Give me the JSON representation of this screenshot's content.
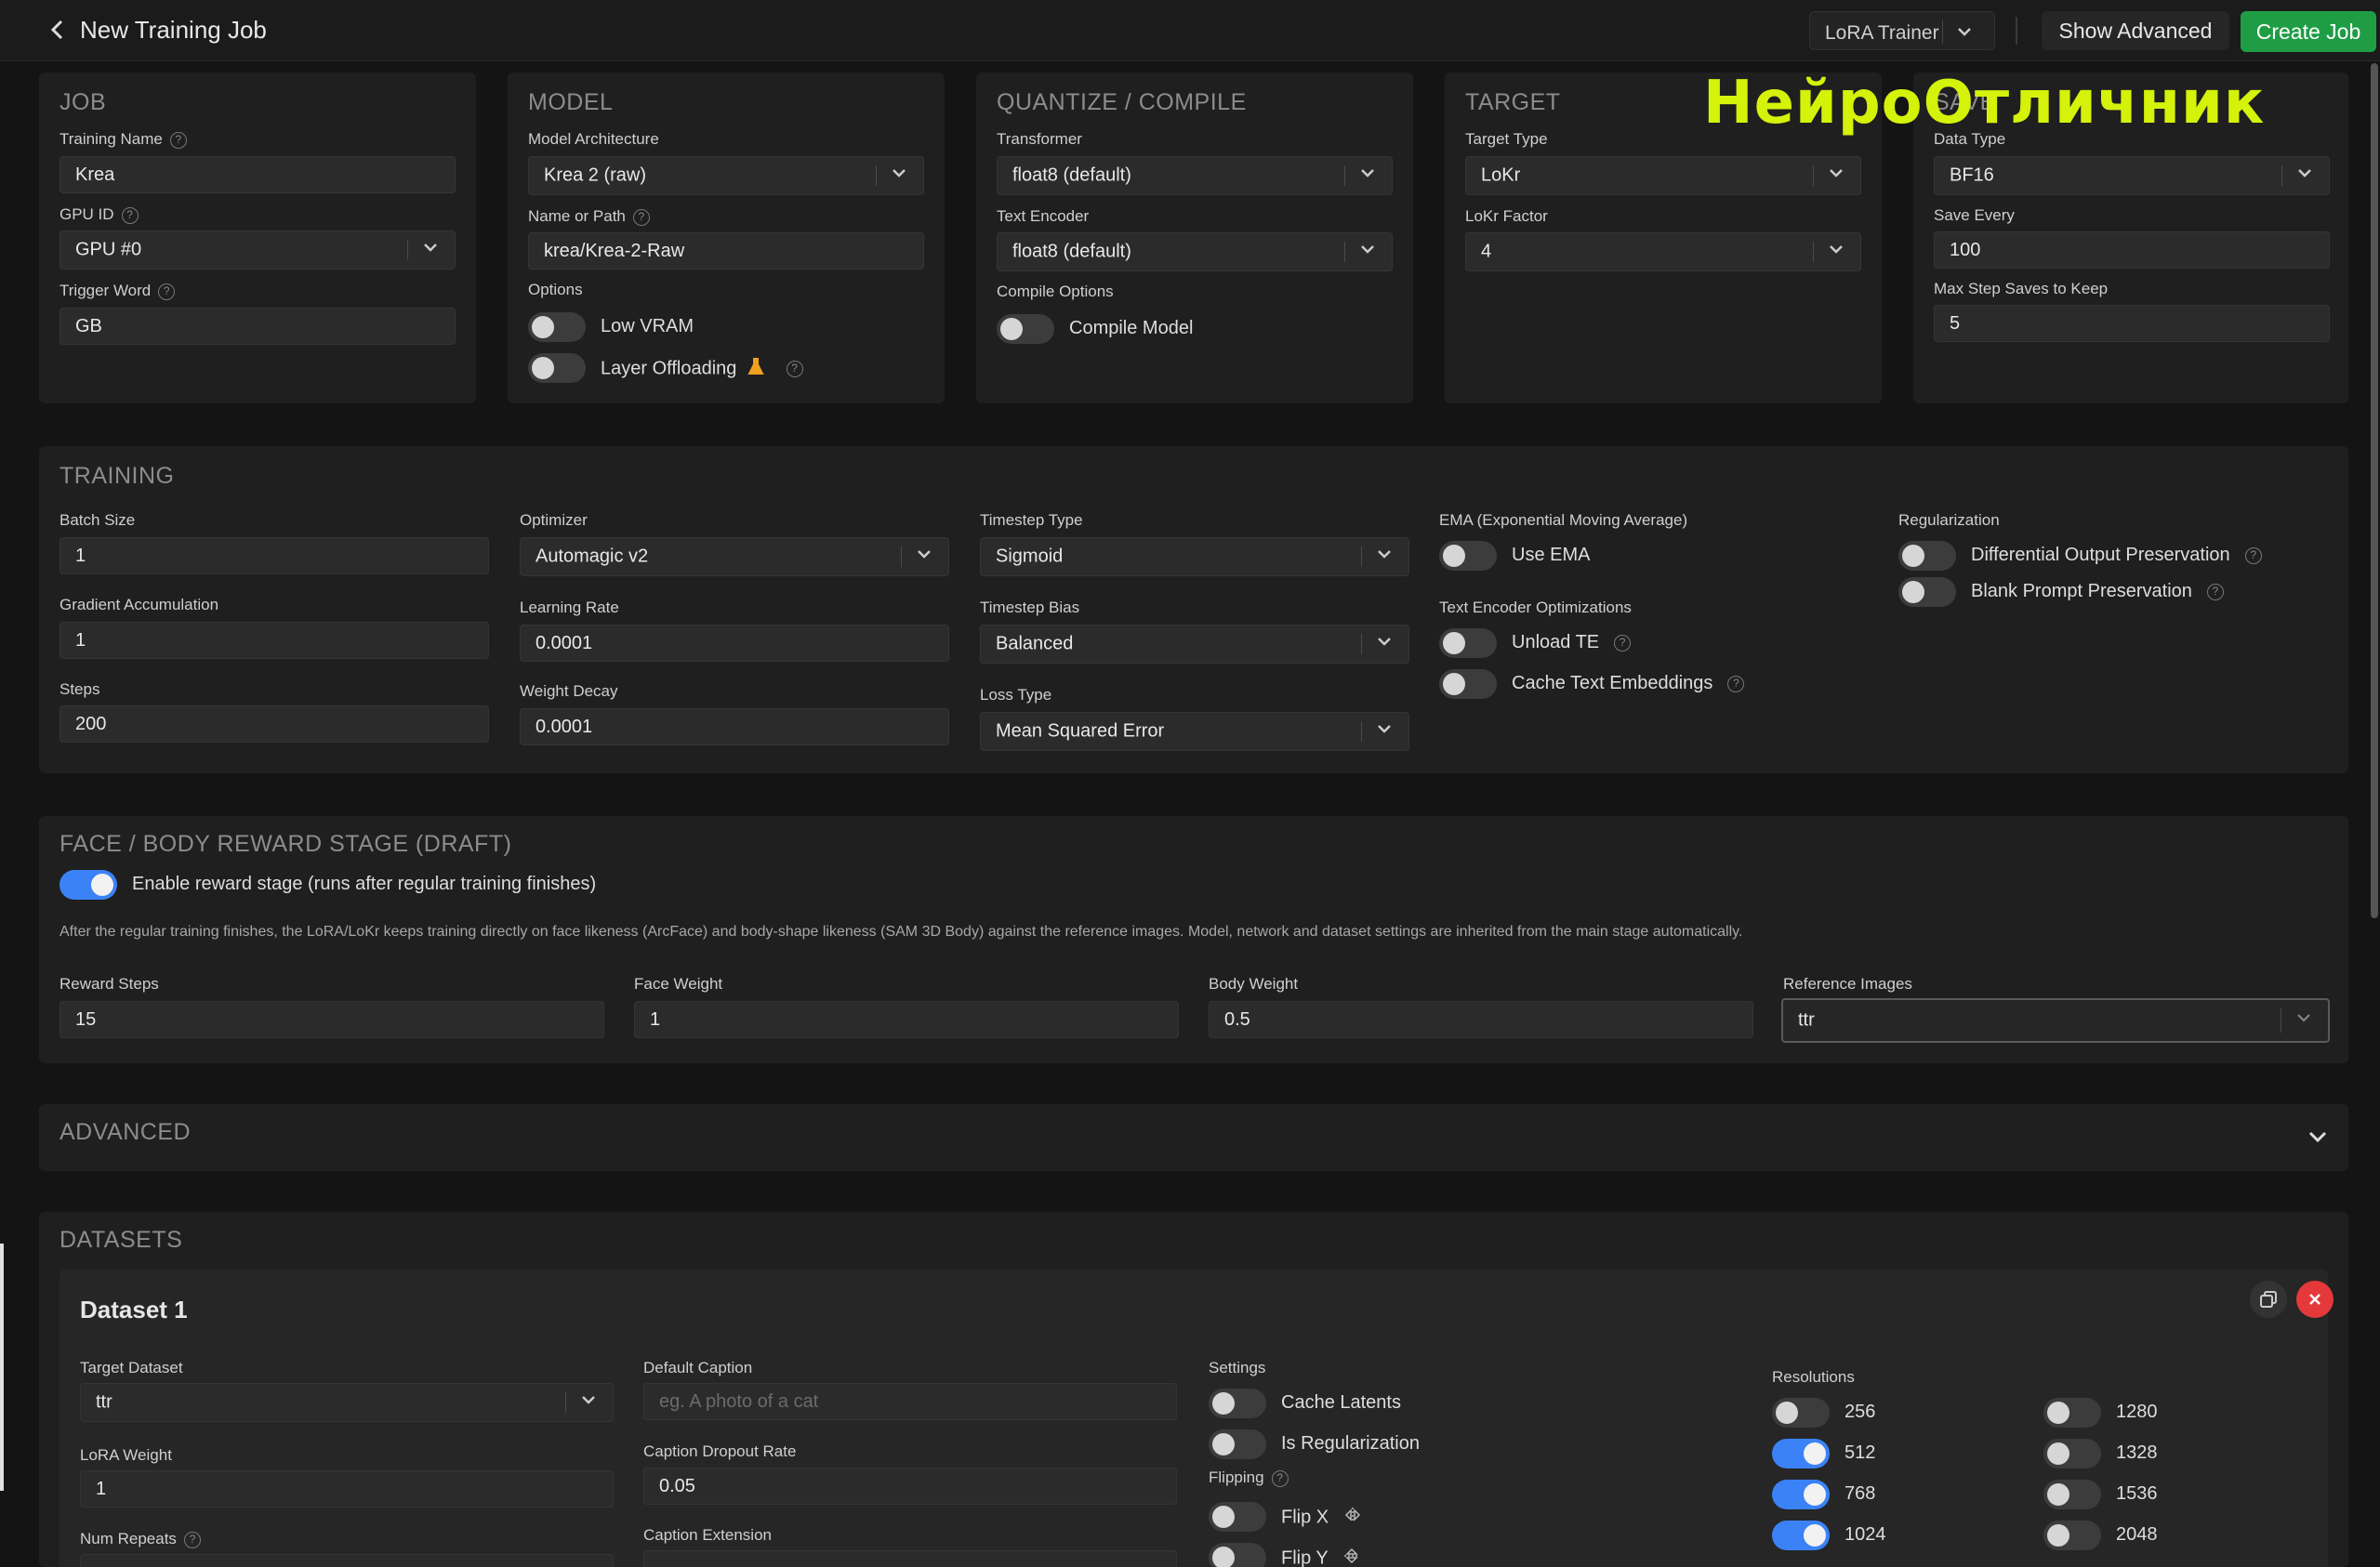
{
  "header": {
    "title": "New Training Job",
    "trainer": "LoRA Trainer",
    "show_advanced": "Show Advanced",
    "create_job": "Create Job"
  },
  "watermark": "НейроОтличник",
  "job": {
    "title": "JOB",
    "training_name_label": "Training Name",
    "training_name": "Krea",
    "gpu_label": "GPU ID",
    "gpu": "GPU #0",
    "trigger_label": "Trigger Word",
    "trigger": "GB"
  },
  "model": {
    "title": "MODEL",
    "arch_label": "Model Architecture",
    "arch": "Krea 2 (raw)",
    "path_label": "Name or Path",
    "path": "krea/Krea-2-Raw",
    "options_label": "Options",
    "low_vram": "Low VRAM",
    "layer_offloading": "Layer Offloading"
  },
  "quantize": {
    "title": "QUANTIZE / COMPILE",
    "transformer_label": "Transformer",
    "transformer": "float8 (default)",
    "text_encoder_label": "Text Encoder",
    "text_encoder": "float8 (default)",
    "compile_label": "Compile Options",
    "compile_model": "Compile Model"
  },
  "target": {
    "title": "TARGET",
    "type_label": "Target Type",
    "type": "LoKr",
    "factor_label": "LoKr Factor",
    "factor": "4"
  },
  "save": {
    "title": "SAVE",
    "dtype_label": "Data Type",
    "dtype": "BF16",
    "every_label": "Save Every",
    "every": "100",
    "max_label": "Max Step Saves to Keep",
    "max": "5"
  },
  "training": {
    "title": "TRAINING",
    "batch_label": "Batch Size",
    "batch": "1",
    "grad_label": "Gradient Accumulation",
    "grad": "1",
    "steps_label": "Steps",
    "steps": "200",
    "optimizer_label": "Optimizer",
    "optimizer": "Automagic v2",
    "lr_label": "Learning Rate",
    "lr": "0.0001",
    "wd_label": "Weight Decay",
    "wd": "0.0001",
    "ts_type_label": "Timestep Type",
    "ts_type": "Sigmoid",
    "ts_bias_label": "Timestep Bias",
    "ts_bias": "Balanced",
    "loss_label": "Loss Type",
    "loss": "Mean Squared Error",
    "ema_label": "EMA (Exponential Moving Average)",
    "use_ema": "Use EMA",
    "te_opt_label": "Text Encoder Optimizations",
    "unload_te": "Unload TE",
    "cache_te": "Cache Text Embeddings",
    "reg_label": "Regularization",
    "dop": "Differential Output Preservation",
    "bpp": "Blank Prompt Preservation"
  },
  "reward": {
    "title": "FACE / BODY REWARD STAGE (DRAFT)",
    "enable": "Enable reward stage (runs after regular training finishes)",
    "description": "After the regular training finishes, the LoRA/LoKr keeps training directly on face likeness (ArcFace) and body-shape likeness (SAM 3D Body) against the reference images. Model, network and dataset settings are inherited from the main stage automatically.",
    "steps_label": "Reward Steps",
    "steps": "15",
    "face_label": "Face Weight",
    "face": "1",
    "body_label": "Body Weight",
    "body": "0.5",
    "ref_label": "Reference Images",
    "ref": "ttr"
  },
  "advanced": {
    "title": "ADVANCED"
  },
  "datasets": {
    "title": "DATASETS",
    "dataset_name": "Dataset 1",
    "target_label": "Target Dataset",
    "target": "ttr",
    "lora_weight_label": "LoRA Weight",
    "lora_weight": "1",
    "num_repeats_label": "Num Repeats",
    "default_caption_label": "Default Caption",
    "default_caption_placeholder": "eg. A photo of a cat",
    "dropout_label": "Caption Dropout Rate",
    "dropout": "0.05",
    "caption_ext_label": "Caption Extension",
    "settings_label": "Settings",
    "cache_latents": "Cache Latents",
    "is_reg": "Is Regularization",
    "flipping_label": "Flipping",
    "flip_x": "Flip X",
    "flip_y": "Flip Y",
    "resolutions_label": "Resolutions",
    "resolutions": [
      {
        "value": "256",
        "on": false
      },
      {
        "value": "512",
        "on": true
      },
      {
        "value": "768",
        "on": true
      },
      {
        "value": "1024",
        "on": true
      },
      {
        "value": "1280",
        "on": false
      },
      {
        "value": "1328",
        "on": false
      },
      {
        "value": "1536",
        "on": false
      },
      {
        "value": "2048",
        "on": false
      }
    ]
  }
}
